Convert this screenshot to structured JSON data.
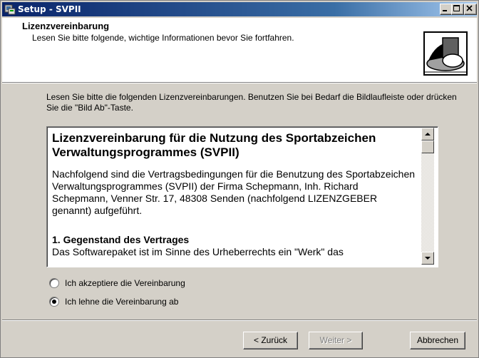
{
  "window": {
    "title": "Setup - SVPII"
  },
  "header": {
    "title": "Lizenzvereinbarung",
    "subtitle": "Lesen Sie bitte folgende, wichtige Informationen bevor Sie fortfahren."
  },
  "intro": {
    "text": "Lesen Sie bitte die folgenden Lizenzvereinbarungen. Benutzen Sie bei Bedarf die Bildlaufleiste oder drücken Sie die \"Bild Ab\"-Taste."
  },
  "license": {
    "heading": "Lizenzvereinbarung für die Nutzung des Sportabzeichen Verwaltungsprogrammes (SVPII)",
    "paragraph": "Nachfolgend sind die Vertragsbedingungen für die Benutzung des Sportabzeichen Verwaltungsprogrammes (SVPII) der Firma Schepmann, Inh. Richard Schepmann, Venner Str. 17, 48308 Senden (nachfolgend LIZENZGEBER genannt) aufgeführt.",
    "section1_title": "1. Gegenstand des Vertrages",
    "section1_text": "Das Softwarepaket ist im Sinne des Urheberrechts ein \"Werk\" das"
  },
  "options": {
    "accept": "Ich akzeptiere die Vereinbarung",
    "decline": "Ich lehne die Vereinbarung ab",
    "selected": "decline"
  },
  "buttons": {
    "back": "< Zurück",
    "next": "Weiter >",
    "cancel": "Abbrechen"
  }
}
